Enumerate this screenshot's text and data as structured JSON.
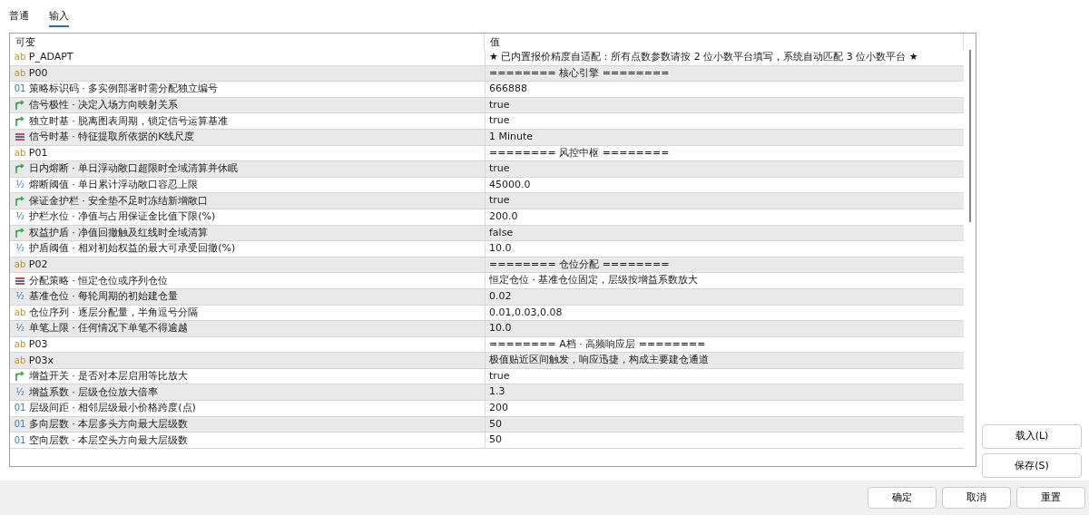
{
  "tabs": [
    {
      "label": "普通",
      "selected": false
    },
    {
      "label": "输入",
      "selected": true
    }
  ],
  "table": {
    "columns": [
      "可变",
      "值"
    ],
    "rows": [
      {
        "kind": "string",
        "icon": "ab",
        "name": "P_ADAPT",
        "value": "★ 已内置报价精度自适配：所有点数参数请按 2 位小数平台填写，系统自动匹配 3 位小数平台 ★"
      },
      {
        "kind": "string",
        "icon": "ab",
        "name": "P00",
        "value": "======== 核心引擎 ========"
      },
      {
        "kind": "int",
        "icon": "01",
        "name": "策略标识码 · 多实例部署时需分配独立编号",
        "value": "666888"
      },
      {
        "kind": "bool",
        "name": "信号极性 · 决定入场方向映射关系",
        "value": "true"
      },
      {
        "kind": "bool",
        "name": "独立时基 · 脱离图表周期，锁定信号运算基准",
        "value": "true"
      },
      {
        "kind": "enum",
        "name": "信号时基 · 特征提取所依据的K线尺度",
        "value": "1 Minute"
      },
      {
        "kind": "string",
        "icon": "ab",
        "name": "P01",
        "value": "======== 风控中枢 ========"
      },
      {
        "kind": "bool",
        "name": "日内熔断 · 单日浮动敞口超限时全域清算并休眠",
        "value": "true"
      },
      {
        "kind": "double",
        "icon": "½",
        "name": "熔断阈值 · 单日累计浮动敞口容忍上限",
        "value": "45000.0"
      },
      {
        "kind": "bool",
        "name": "保证金护栏 · 安全垫不足时冻结新增敞口",
        "value": "true"
      },
      {
        "kind": "double",
        "icon": "½",
        "name": "护栏水位 · 净值与占用保证金比值下限(%)",
        "value": "200.0"
      },
      {
        "kind": "bool",
        "name": "权益护盾 · 净值回撤触及红线时全域清算",
        "value": "false"
      },
      {
        "kind": "double",
        "icon": "½",
        "name": "护盾阈值 · 相对初始权益的最大可承受回撤(%)",
        "value": "10.0"
      },
      {
        "kind": "string",
        "icon": "ab",
        "name": "P02",
        "value": "======== 仓位分配 ========"
      },
      {
        "kind": "enum",
        "name": "分配策略 · 恒定仓位或序列仓位",
        "value": "恒定仓位 · 基准仓位固定，层级按增益系数放大"
      },
      {
        "kind": "double",
        "icon": "½",
        "name": "基准仓位 · 每轮周期的初始建仓量",
        "value": "0.02"
      },
      {
        "kind": "string",
        "icon": "ab",
        "name": "仓位序列 · 逐层分配量，半角逗号分隔",
        "value": "0.01,0.03,0.08"
      },
      {
        "kind": "double",
        "icon": "½",
        "name": "单笔上限 · 任何情况下单笔不得逾越",
        "value": "10.0"
      },
      {
        "kind": "string",
        "icon": "ab",
        "name": "P03",
        "value": "======== A档 · 高频响应层 ========"
      },
      {
        "kind": "string",
        "icon": "ab",
        "name": "P03x",
        "value": "极值贴近区间触发，响应迅捷，构成主要建仓通道"
      },
      {
        "kind": "bool",
        "name": "增益开关 · 是否对本层启用等比放大",
        "value": "true"
      },
      {
        "kind": "double",
        "icon": "½",
        "name": "增益系数 · 层级仓位放大倍率",
        "value": "1.3"
      },
      {
        "kind": "int",
        "icon": "01",
        "name": "层级间距 · 相邻层级最小价格跨度(点)",
        "value": "200"
      },
      {
        "kind": "int",
        "icon": "01",
        "name": "多向层数 · 本层多头方向最大层级数",
        "value": "50"
      },
      {
        "kind": "int",
        "icon": "01",
        "name": "空向层数 · 本层空头方向最大层级数",
        "value": "50"
      }
    ]
  },
  "side_buttons": [
    "载入(L)",
    "保存(S)"
  ],
  "footer_buttons": [
    "确定",
    "取消",
    "重置"
  ]
}
